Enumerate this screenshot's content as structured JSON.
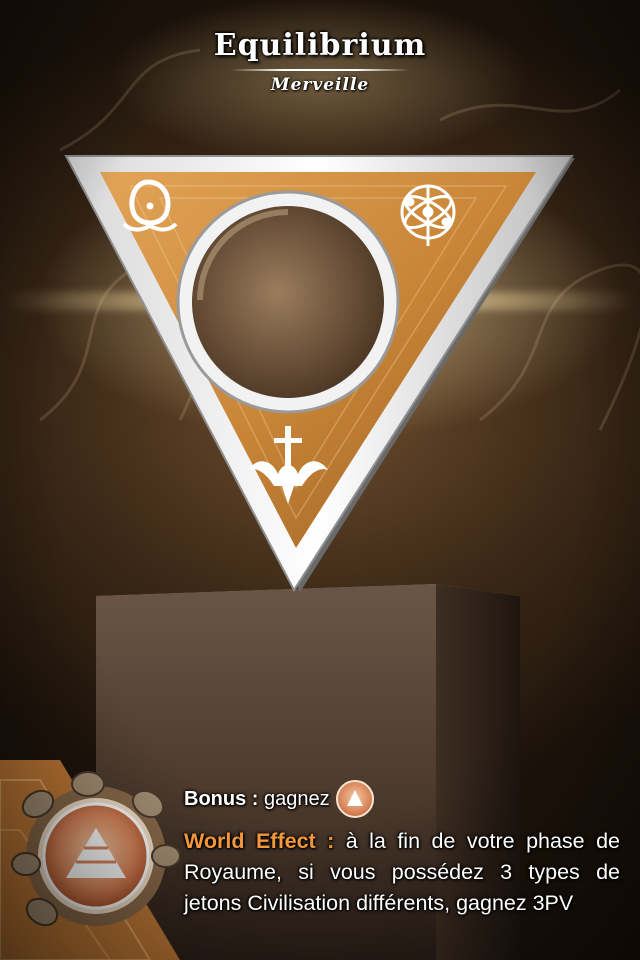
{
  "card": {
    "title": "Equilibrium",
    "type": "Merveille",
    "bonus_label": "Bonus :",
    "bonus_text": "gagnez",
    "effect_label": "World Effect :",
    "effect_text": "à la fin de votre phase de Royaume, si vous possédez 3 types de jetons Civilisation différents, gagnez 3PV"
  },
  "icons": {
    "top_left": "eye-glyph-icon",
    "top_right": "atom-orbit-icon",
    "bottom": "sword-crown-icon",
    "bonus_token": "pyramid-token-icon",
    "corner_token": "pyramid-token-icon"
  },
  "colors": {
    "effect_label": "#f2973a",
    "token_orange": "#d9855a",
    "frame_silver": "#e6e6e6",
    "panel_orange": "#d08a3a"
  }
}
